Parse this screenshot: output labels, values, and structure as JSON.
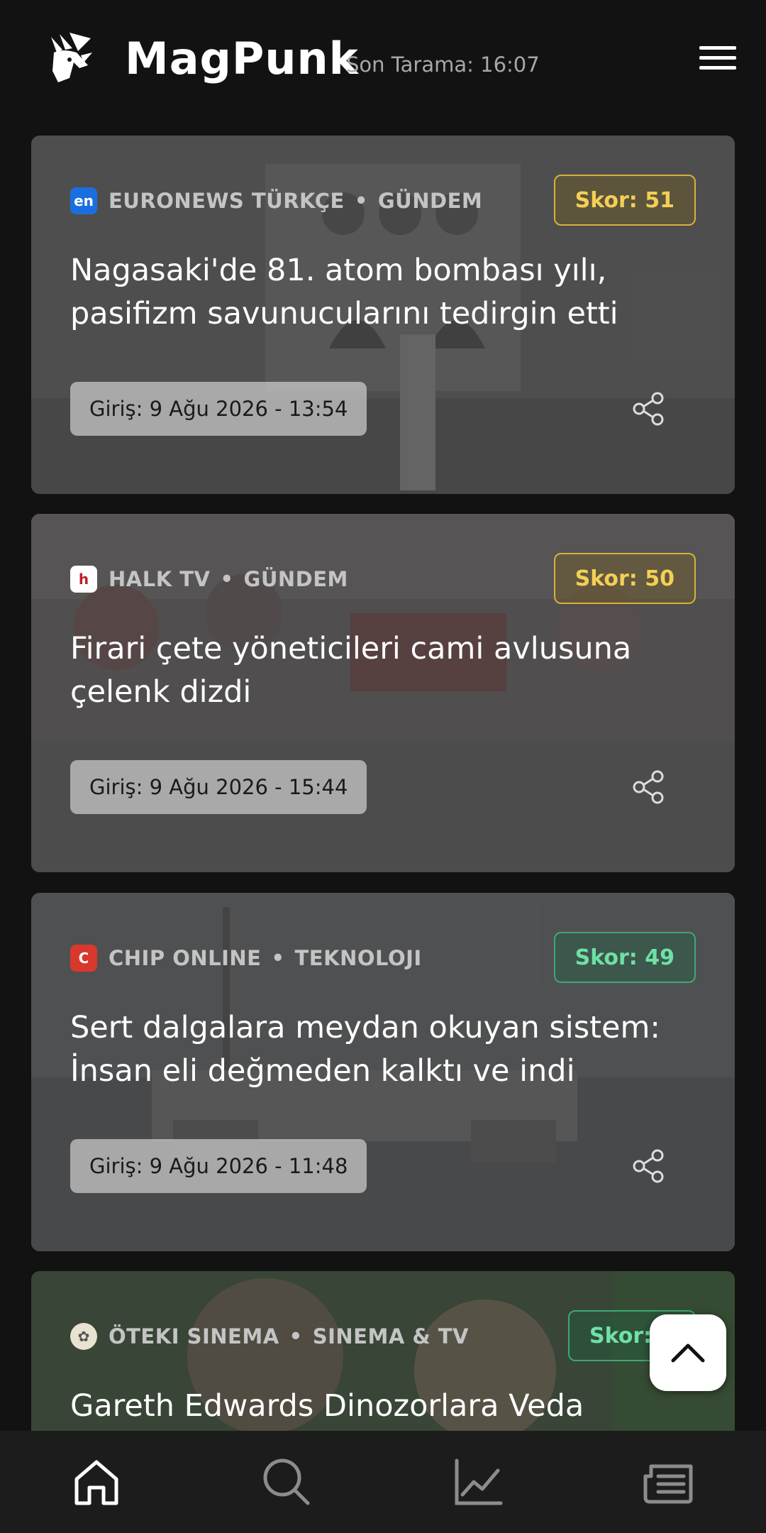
{
  "header": {
    "app_title": "MagPunk",
    "last_scan": "Son Tarama: 16:07",
    "logo_icon": "goat-logo-icon",
    "menu_icon": "hamburger-menu-icon"
  },
  "articles": [
    {
      "source": "EURONEWS TÜRKÇE",
      "category": "GÜNDEM",
      "score_label": "Skor: 51",
      "score_color": "yellow",
      "headline": "Nagasaki'de 81. atom bombası yılı, pasifizm savunucularını tedirgin etti",
      "date": "Giriş: 9 Ağu 2026 - 13:54",
      "source_icon": "euronews-icon"
    },
    {
      "source": "HALK TV",
      "category": "GÜNDEM",
      "score_label": "Skor: 50",
      "score_color": "yellow",
      "headline": "Firari çete yöneticileri cami avlusuna çelenk dizdi",
      "date": "Giriş: 9 Ağu 2026 - 15:44",
      "source_icon": "halktv-icon"
    },
    {
      "source": "CHIP ONLINE",
      "category": "TEKNOLOJI",
      "score_label": "Skor: 49",
      "score_color": "green",
      "headline": "Sert dalgalara meydan okuyan sistem: İnsan eli değmeden kalktı ve indi",
      "date": "Giriş: 9 Ağu 2026 - 11:48",
      "source_icon": "chip-icon"
    },
    {
      "source": "ÖTEKI SINEMA",
      "category": "SINEMA & TV",
      "score_label": "Skor:",
      "score_color": "green",
      "headline": "Gareth Edwards Dinozorlara Veda Ediyor!",
      "source_icon": "oteki-sinema-icon"
    }
  ],
  "colors": {
    "background": "#121212",
    "score_yellow": "#f4cf55",
    "score_green": "#6fe0a6",
    "nav_bar": "#1c1c1c"
  },
  "bottom_nav": [
    "home-icon",
    "search-icon",
    "trending-chart-icon",
    "news-feed-icon"
  ]
}
